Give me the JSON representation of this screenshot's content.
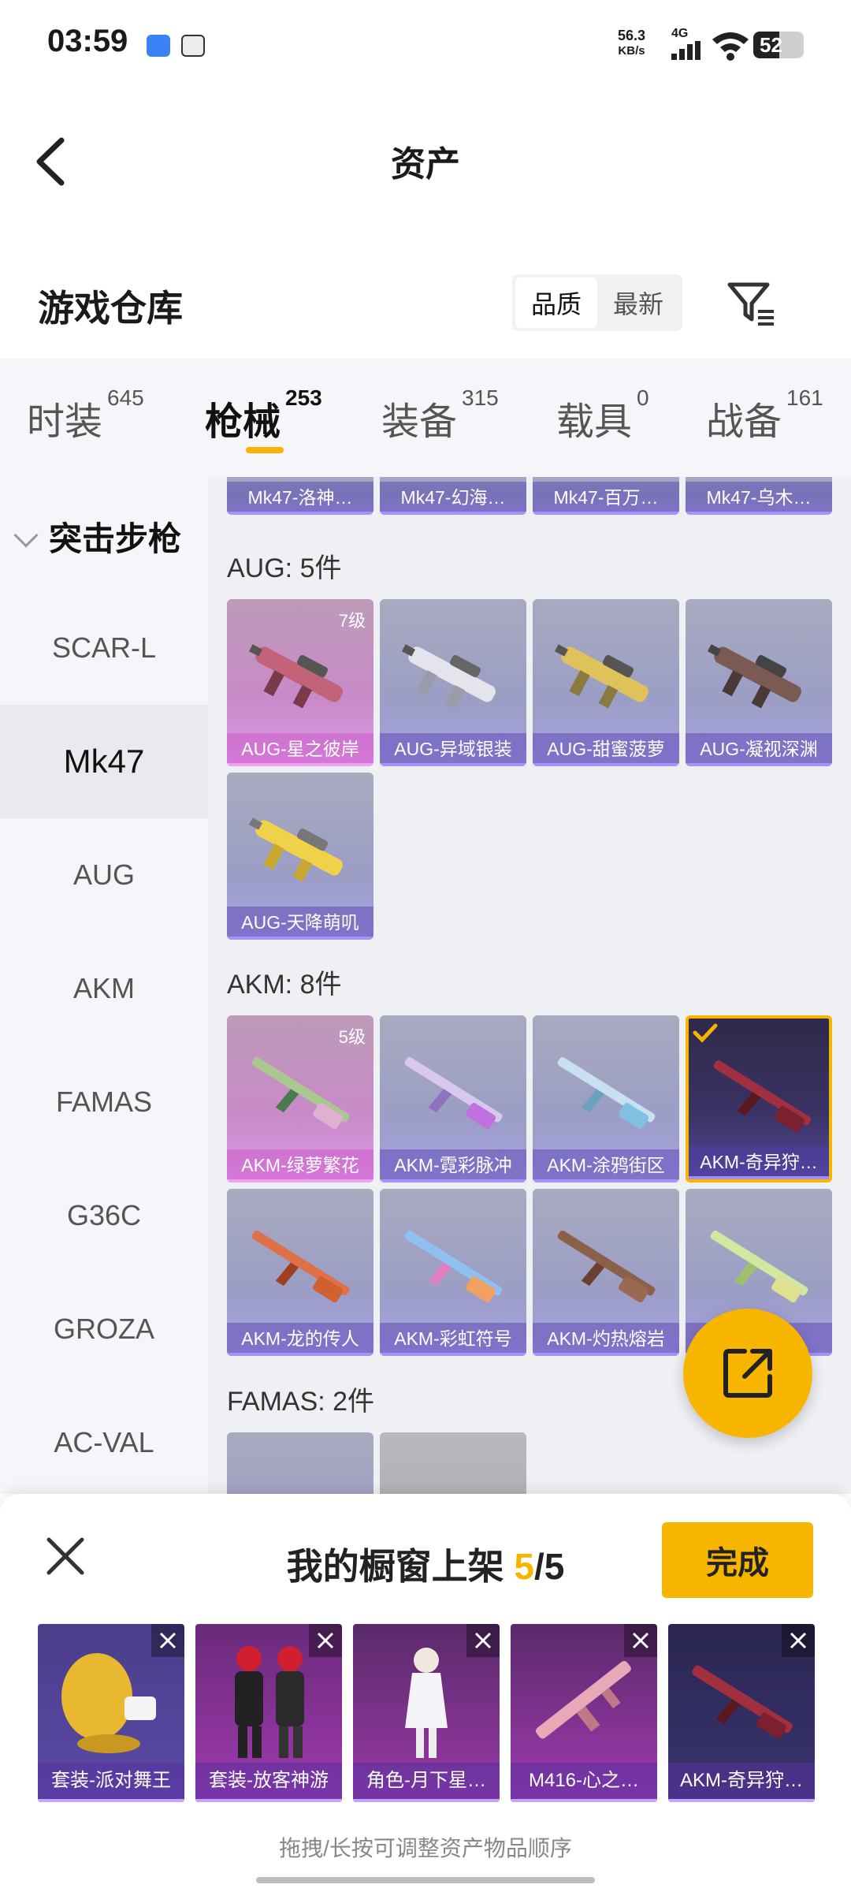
{
  "status_bar": {
    "time": "03:59",
    "net_speed": "56.3",
    "net_unit": "KB/s",
    "signal_type": "4G",
    "battery": "52",
    "battery_level": 0.52
  },
  "header": {
    "title": "资产"
  },
  "warehouse": {
    "title": "游戏仓库",
    "sort_options": [
      "品质",
      "最新"
    ],
    "sort_selected": "品质"
  },
  "tabs": [
    {
      "label": "时装",
      "count": "645"
    },
    {
      "label": "枪械",
      "count": "253",
      "active": true
    },
    {
      "label": "装备",
      "count": "315"
    },
    {
      "label": "载具",
      "count": "0"
    },
    {
      "label": "战备",
      "count": "161"
    }
  ],
  "sidebar": {
    "category": "突击步枪",
    "items": [
      "SCAR-L",
      "Mk47",
      "AUG",
      "AKM",
      "FAMAS",
      "G36C",
      "GROZA",
      "AC-VAL"
    ],
    "selected": "Mk47"
  },
  "groups": {
    "mk47_top": [
      "Mk47-洛神…",
      "Mk47-幻海…",
      "Mk47-百万…",
      "Mk47-乌木…"
    ],
    "aug": {
      "title": "AUG: 5件",
      "items": [
        {
          "name": "AUG-星之彼岸",
          "level": "7级"
        },
        {
          "name": "AUG-异域银装"
        },
        {
          "name": "AUG-甜蜜菠萝"
        },
        {
          "name": "AUG-凝视深渊"
        },
        {
          "name": "AUG-天降萌叽"
        }
      ]
    },
    "akm": {
      "title": "AKM: 8件",
      "items": [
        {
          "name": "AKM-绿萝繁花",
          "level": "5级"
        },
        {
          "name": "AKM-霓彩脉冲"
        },
        {
          "name": "AKM-涂鸦街区"
        },
        {
          "name": "AKM-奇异狩…"
        },
        {
          "name": "AKM-龙的传人"
        },
        {
          "name": "AKM-彩虹符号"
        },
        {
          "name": "AKM-灼热熔岩"
        },
        {
          "name": "…"
        }
      ]
    },
    "famas": {
      "title": "FAMAS: 2件"
    }
  },
  "showcase": {
    "title_prefix": "我的橱窗上架",
    "count": "5",
    "total": "/5",
    "done_label": "完成",
    "items": [
      "套装-派对舞王",
      "套装-放客神游",
      "角色-月下星…",
      "M416-心之…",
      "AKM-奇异狩…"
    ],
    "hint": "拖拽/长按可调整资产物品顺序"
  },
  "colors": {
    "accent": "#f7b500"
  }
}
